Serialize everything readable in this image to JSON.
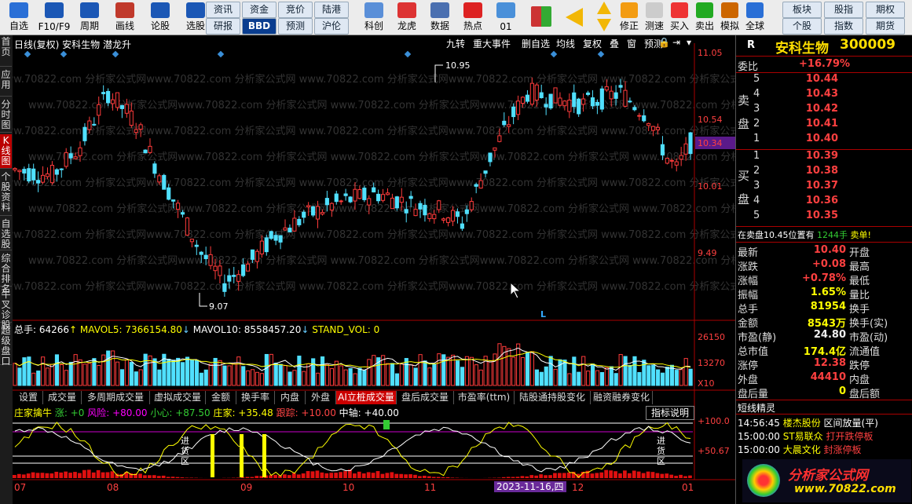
{
  "toolbar": {
    "left_buttons": [
      {
        "label": "自选",
        "icon": "star-icon"
      },
      {
        "label": "F10/F9",
        "icon": "f10-icon"
      },
      {
        "label": "周期",
        "icon": "clock-icon"
      },
      {
        "label": "画线",
        "icon": "pencil-icon"
      },
      {
        "label": "论股",
        "icon": "discuss-icon"
      },
      {
        "label": "选股",
        "icon": "stock-select-icon"
      }
    ],
    "mid_small": [
      [
        "资讯",
        "资金",
        "竞价",
        "陆港"
      ],
      [
        "研报",
        "BBD",
        "预测",
        "沪伦"
      ]
    ],
    "mid_buttons": [
      {
        "label": "科创",
        "icon": "sci-icon"
      },
      {
        "label": "龙虎",
        "icon": "dragon-icon"
      },
      {
        "label": "数据",
        "icon": "data-icon"
      },
      {
        "label": "热点",
        "icon": "hot-icon"
      },
      {
        "label": "01",
        "icon": "ipo-icon"
      }
    ],
    "right_buttons": [
      {
        "label": "修正",
        "icon": "fix-icon"
      },
      {
        "label": "测速",
        "icon": "speed-icon"
      },
      {
        "label": "买入",
        "icon": "buy-icon"
      },
      {
        "label": "卖出",
        "icon": "sell-icon"
      },
      {
        "label": "模拟",
        "icon": "hammer-icon"
      },
      {
        "label": "全球",
        "icon": "globe-icon"
      }
    ],
    "right_small": [
      [
        "板块",
        "股指",
        "期权"
      ],
      [
        "个股",
        "指数",
        "期货"
      ]
    ]
  },
  "left_tabs": [
    "首页",
    "应用",
    "分时图",
    "K线图",
    "个股资料",
    "自选股",
    "综合排名",
    "牛叉诊股",
    "超级盘口"
  ],
  "chart": {
    "header": "日线(复权) 安科生物 潜龙升",
    "menu": [
      "九转",
      "重大事件",
      "删自选",
      "均线",
      "复权",
      "叠",
      "窗",
      "预测"
    ],
    "price_axis": [
      "11.05",
      "10.54",
      "10.34",
      "10.01",
      "9.49"
    ],
    "high_label": "10.95",
    "low_label": "9.07",
    "marker_L": "L",
    "vol_header": {
      "total": "总手: 64266",
      "ma5": "MAVOL5: 7366154.80",
      "ma10": "MAVOL10: 8558457.20",
      "stand": "STAND_VOL: 0"
    },
    "vol_axis": [
      "26150",
      "13270",
      "X10"
    ],
    "tabs": [
      "设置",
      "成交量",
      "多周期成交量",
      "虚拟成交量",
      "金额",
      "换手率",
      "内盘",
      "外盘",
      "AI立桩成交量",
      "盘后成交量",
      "市盈率(ttm)",
      "陆股通持股变化",
      "融资融券变化"
    ],
    "ind_header": {
      "name": "庄家擒牛",
      "zhang": "涨: +0",
      "risk": "风险: +80.00",
      "xx": "小心: +87.50",
      "zj": "庄家: +35.48",
      "gz": "跟踪: +10.00",
      "zz": "中轴: +40.00"
    },
    "ind_btn": "指标说明",
    "ind_axis": [
      "+100.0",
      "+50.67"
    ],
    "ind_text": "进货区",
    "x_axis": [
      "07",
      "08",
      "09",
      "10",
      "11",
      "12",
      "01"
    ],
    "cursor_date": "2023-11-16,四",
    "watermark": "www.70822.com 分析家公式网"
  },
  "right_panel": {
    "title": "安科生物",
    "code": "300009",
    "r": "R",
    "weibi": {
      "label": "委比",
      "value": "+16.79%"
    },
    "sell": [
      {
        "n": "5",
        "p": "10.44"
      },
      {
        "n": "4",
        "p": "10.43"
      },
      {
        "n": "3",
        "p": "10.42"
      },
      {
        "n": "2",
        "p": "10.41"
      },
      {
        "n": "1",
        "p": "10.40"
      }
    ],
    "buy": [
      {
        "n": "1",
        "p": "10.39"
      },
      {
        "n": "2",
        "p": "10.38"
      },
      {
        "n": "3",
        "p": "10.37"
      },
      {
        "n": "4",
        "p": "10.36"
      },
      {
        "n": "5",
        "p": "10.35"
      }
    ],
    "sell_lbl": [
      "卖",
      "盘"
    ],
    "buy_lbl": [
      "买",
      "盘"
    ],
    "notice": {
      "text": "在卖盘10.45位置有",
      "vol": "1244手",
      "act": "卖单!"
    },
    "stats": [
      {
        "l": "最新",
        "v": "10.40",
        "c": "red",
        "l2": "开盘"
      },
      {
        "l": "涨跌",
        "v": "+0.08",
        "c": "red",
        "l2": "最高"
      },
      {
        "l": "涨幅",
        "v": "+0.78%",
        "c": "red",
        "l2": "最低"
      },
      {
        "l": "振幅",
        "v": "1.65%",
        "c": "yel",
        "l2": "量比"
      },
      {
        "l": "总手",
        "v": "81954",
        "c": "yel",
        "l2": "换手"
      },
      {
        "l": "金额",
        "v": "8543万",
        "c": "yel",
        "l2": "换手(实)"
      },
      {
        "l": "市盈(静)",
        "v": "24.80",
        "c": "wht",
        "l2": "市盈(动)"
      },
      {
        "l": "总市值",
        "v": "174.4亿",
        "c": "yel",
        "l2": "流通值"
      },
      {
        "l": "涨停",
        "v": "12.38",
        "c": "red",
        "l2": "跌停"
      },
      {
        "l": "外盘",
        "v": "44410",
        "c": "red",
        "l2": "内盘"
      },
      {
        "l": "盘后量",
        "v": "0",
        "c": "yel",
        "l2": "盘后额"
      }
    ],
    "short_title": "短线精灵",
    "short_rows": [
      {
        "t": "14:56:45",
        "s": "楼杰股份",
        "e": "区间放量(平)"
      },
      {
        "t": "15:00:00",
        "s": "ST易联众",
        "e": "打开跌停板"
      },
      {
        "t": "15:00:00",
        "s": "大晨文化",
        "e": "封涨停板"
      }
    ],
    "logo": "分析家公式网",
    "logo_url": "www.70822.com"
  }
}
